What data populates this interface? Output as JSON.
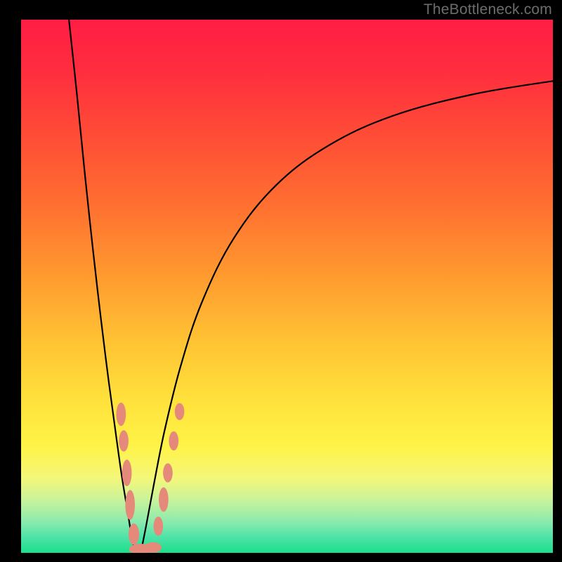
{
  "watermark": "TheBottleneck.com",
  "frame": {
    "outer_w": 800,
    "outer_h": 800,
    "inner_left": 30,
    "inner_top": 28,
    "inner_w": 757,
    "inner_h": 759,
    "bg": "#000000"
  },
  "gradient_stops": [
    {
      "offset": 0.0,
      "color": "#ff1d44"
    },
    {
      "offset": 0.1,
      "color": "#ff2e3e"
    },
    {
      "offset": 0.22,
      "color": "#ff4d36"
    },
    {
      "offset": 0.35,
      "color": "#ff7030"
    },
    {
      "offset": 0.48,
      "color": "#ff9a2f"
    },
    {
      "offset": 0.6,
      "color": "#ffc233"
    },
    {
      "offset": 0.72,
      "color": "#ffe33c"
    },
    {
      "offset": 0.8,
      "color": "#fff347"
    },
    {
      "offset": 0.86,
      "color": "#f4f77a"
    },
    {
      "offset": 0.9,
      "color": "#c9f39a"
    },
    {
      "offset": 0.94,
      "color": "#8eebad"
    },
    {
      "offset": 0.97,
      "color": "#4fe3a8"
    },
    {
      "offset": 1.0,
      "color": "#1adf8a"
    }
  ],
  "chart_data": {
    "type": "line",
    "title": "",
    "xlabel": "",
    "ylabel": "",
    "xlim": [
      0,
      100
    ],
    "ylim": [
      0,
      100
    ],
    "note": "Two V-shaped bottleneck curves meeting near x≈21. Values are percentage bottleneck (0=green, 100=red) read off the vertical gradient.",
    "series": [
      {
        "name": "left-curve",
        "x": [
          9.0,
          10.5,
          12.0,
          13.5,
          15.0,
          16.5,
          18.0,
          19.0,
          20.0,
          20.8,
          21.5
        ],
        "y": [
          100.0,
          86.0,
          71.0,
          57.0,
          44.0,
          32.0,
          21.0,
          14.0,
          8.0,
          3.0,
          0.0
        ]
      },
      {
        "name": "right-curve",
        "x": [
          22.5,
          23.5,
          25.0,
          27.0,
          30.0,
          34.0,
          40.0,
          48.0,
          58.0,
          70.0,
          85.0,
          100.0
        ],
        "y": [
          0.0,
          5.0,
          13.0,
          23.0,
          35.0,
          47.0,
          59.0,
          69.0,
          76.5,
          82.0,
          86.0,
          88.5
        ]
      }
    ],
    "markers": [
      {
        "cx": 18.8,
        "cy": 26.0,
        "rx": 0.9,
        "ry": 2.2
      },
      {
        "cx": 19.3,
        "cy": 21.0,
        "rx": 0.9,
        "ry": 2.0
      },
      {
        "cx": 19.9,
        "cy": 15.0,
        "rx": 0.9,
        "ry": 2.5
      },
      {
        "cx": 20.5,
        "cy": 9.0,
        "rx": 0.9,
        "ry": 2.8
      },
      {
        "cx": 21.2,
        "cy": 3.5,
        "rx": 1.0,
        "ry": 2.0
      },
      {
        "cx": 22.5,
        "cy": 0.7,
        "rx": 2.2,
        "ry": 1.0
      },
      {
        "cx": 24.8,
        "cy": 1.0,
        "rx": 1.6,
        "ry": 1.0
      },
      {
        "cx": 25.8,
        "cy": 5.0,
        "rx": 0.9,
        "ry": 1.8
      },
      {
        "cx": 26.8,
        "cy": 10.0,
        "rx": 0.9,
        "ry": 2.3
      },
      {
        "cx": 27.6,
        "cy": 15.0,
        "rx": 0.9,
        "ry": 1.8
      },
      {
        "cx": 28.7,
        "cy": 21.0,
        "rx": 0.9,
        "ry": 1.8
      },
      {
        "cx": 29.8,
        "cy": 26.5,
        "rx": 0.9,
        "ry": 1.6
      }
    ]
  },
  "colors": {
    "curve": "#000000",
    "marker_fill": "#e58a7a",
    "marker_stroke": "#c76a5a"
  }
}
